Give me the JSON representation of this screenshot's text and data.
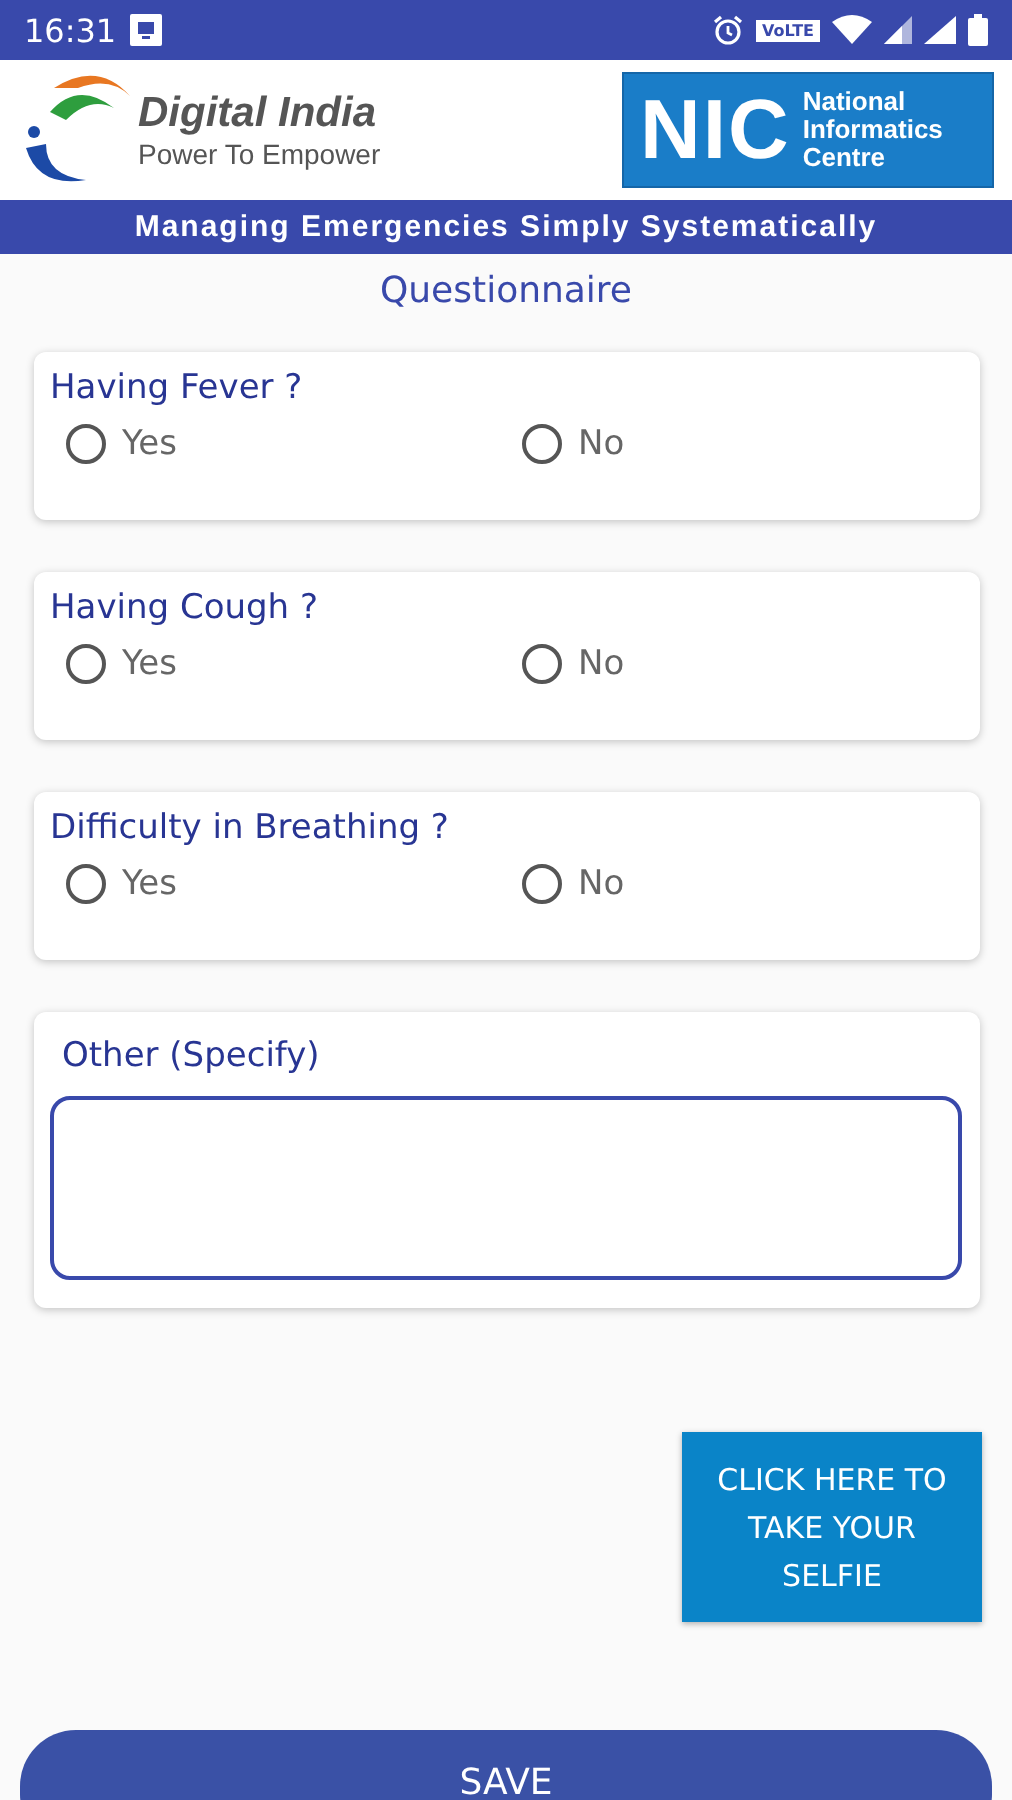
{
  "status_bar": {
    "time": "16:31",
    "network_badge": "VoLTE"
  },
  "header": {
    "logo_title": "Digital India",
    "logo_tagline": "Power To Empower",
    "nic_mark": "NIC",
    "nic_name": [
      "National",
      "Informatics",
      "Centre"
    ]
  },
  "banner": "Managing Emergencies Simply Systematically",
  "title": "Questionnaire",
  "questions": [
    {
      "label": "Having Fever ?",
      "options": [
        {
          "label": "Yes",
          "selected": false
        },
        {
          "label": "No",
          "selected": false
        }
      ]
    },
    {
      "label": "Having Cough ?",
      "options": [
        {
          "label": "Yes",
          "selected": false
        },
        {
          "label": "No",
          "selected": false
        }
      ]
    },
    {
      "label": "Difficulty in Breathing ?",
      "options": [
        {
          "label": "Yes",
          "selected": false
        },
        {
          "label": "No",
          "selected": false
        }
      ]
    }
  ],
  "other": {
    "label": "Other (Specify)"
  },
  "selfie_button": "CLICK HERE TO TAKE YOUR SELFIE",
  "save_button": "SAVE"
}
